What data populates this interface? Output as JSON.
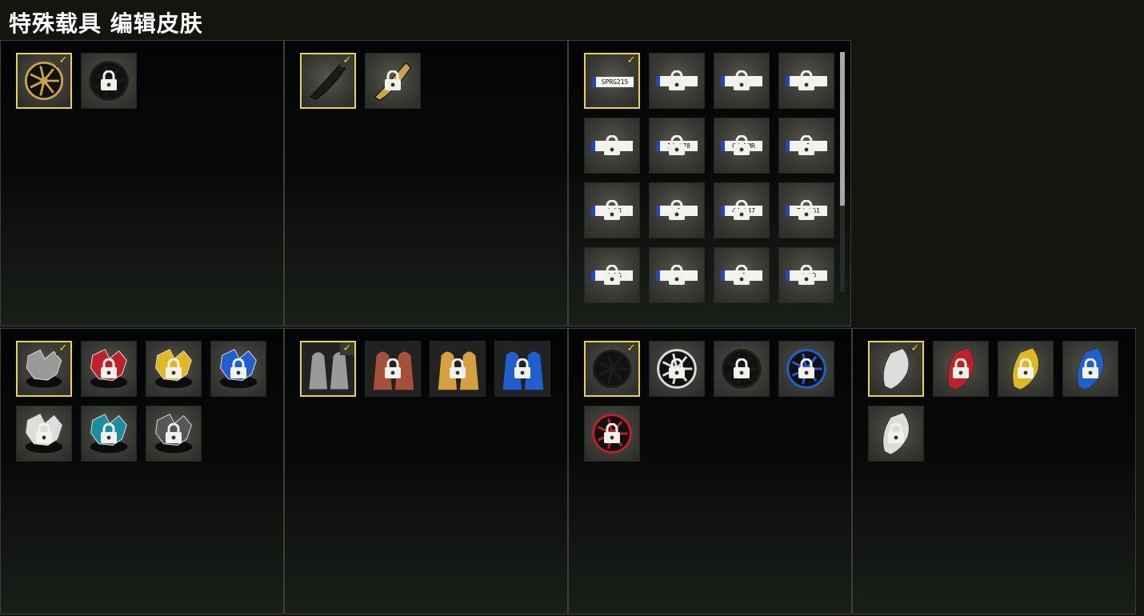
{
  "header": {
    "title": "特殊载具 编辑皮肤"
  },
  "colors": {
    "selected_border": "#e6d25c",
    "plate_blue": "#2546c4"
  },
  "lock_icon": "padlock-icon",
  "check_icon": "checkmark-icon",
  "panels": [
    {
      "name": "wheel-panel",
      "items": [
        {
          "icon": "gold-rim-icon",
          "selected": true,
          "locked": false
        },
        {
          "icon": "black-rim-icon",
          "selected": false,
          "locked": true
        }
      ]
    },
    {
      "name": "spoiler-panel",
      "items": [
        {
          "icon": "black-spoiler-icon",
          "selected": true,
          "locked": false
        },
        {
          "icon": "gold-spoiler-icon",
          "selected": false,
          "locked": true
        }
      ]
    },
    {
      "name": "license-plate-panel",
      "scroll_position": 0.0,
      "items": [
        {
          "plate": "SPRG215",
          "selected": true,
          "locked": false
        },
        {
          "plate": "",
          "locked": true
        },
        {
          "plate": "",
          "locked": true
        },
        {
          "plate": "",
          "locked": true
        },
        {
          "plate": "",
          "locked": true
        },
        {
          "plate": "12 678",
          "locked": true
        },
        {
          "plate": "CH DMR",
          "locked": true
        },
        {
          "plate": "D",
          "locked": true
        },
        {
          "plate": "R N3",
          "locked": true
        },
        {
          "plate": "1",
          "locked": true
        },
        {
          "plate": "47 147",
          "locked": true
        },
        {
          "plate": "TY 061",
          "locked": true
        },
        {
          "plate": "D RS",
          "locked": true
        },
        {
          "plate": "",
          "locked": true
        },
        {
          "plate": "G",
          "locked": true
        },
        {
          "plate": "N OD",
          "locked": true
        }
      ]
    },
    {
      "name": "engine-panel",
      "items": [
        {
          "icon": "gray-engine-icon",
          "selected": true,
          "locked": false
        },
        {
          "icon": "red-engine-icon",
          "locked": true
        },
        {
          "icon": "yellow-engine-icon",
          "locked": true
        },
        {
          "icon": "blue-engine-icon",
          "locked": true
        },
        {
          "icon": "white-engine-icon",
          "locked": true
        },
        {
          "icon": "teal-engine-icon",
          "locked": true
        },
        {
          "icon": "carbon-engine-icon",
          "locked": true
        }
      ]
    },
    {
      "name": "seat-panel",
      "items": [
        {
          "icon": "gray-seat-icon",
          "selected": true,
          "locked": false
        },
        {
          "icon": "brown-seat-icon",
          "locked": true
        },
        {
          "icon": "tan-seat-icon",
          "locked": true
        },
        {
          "icon": "blue-seat-icon",
          "locked": true
        }
      ]
    },
    {
      "name": "rim-panel",
      "items": [
        {
          "icon": "black-rim-icon",
          "selected": true,
          "locked": false
        },
        {
          "icon": "silver-rim-icon",
          "locked": true
        },
        {
          "icon": "black-rim-icon",
          "locked": true
        },
        {
          "icon": "blue-rim-icon",
          "locked": true
        },
        {
          "icon": "red-rim-icon",
          "locked": true
        }
      ]
    },
    {
      "name": "caliper-panel",
      "items": [
        {
          "icon": "white-caliper-icon",
          "selected": true,
          "locked": false
        },
        {
          "icon": "red-caliper-icon",
          "locked": true
        },
        {
          "icon": "yellow-caliper-icon",
          "locked": true
        },
        {
          "icon": "blue-caliper-icon",
          "locked": true
        },
        {
          "icon": "white-caliper-icon",
          "locked": true
        }
      ]
    }
  ]
}
